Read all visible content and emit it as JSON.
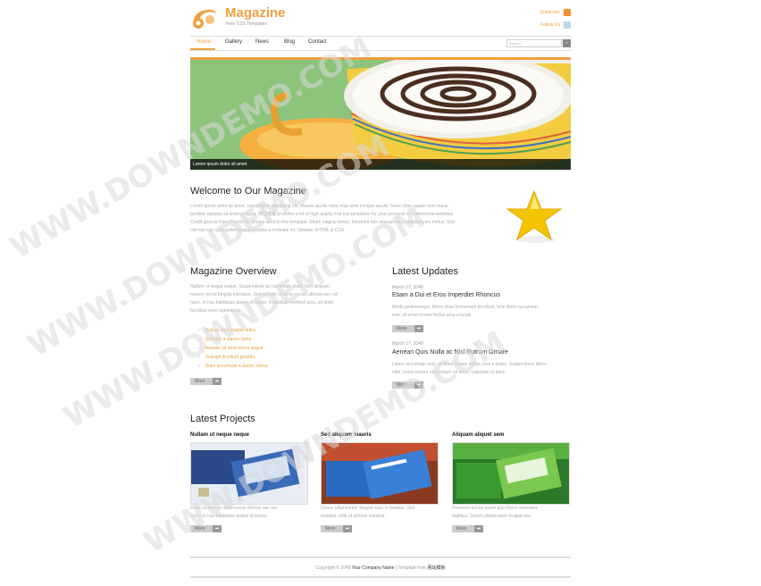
{
  "header": {
    "site_title": "Magazine",
    "tagline": "Free CSS Templates",
    "subscribe": "Subscribe",
    "follow": "Follow Us"
  },
  "nav": {
    "items": [
      "Home",
      "Gallery",
      "News",
      "Blog",
      "Contact"
    ],
    "active": "Home",
    "search_placeholder": "Search...",
    "search_button": "›"
  },
  "hero": {
    "caption": "Lorem ipsum dolor sit amet"
  },
  "welcome": {
    "title": "Welcome to Our Magazine",
    "lines": [
      "Lorem ipsum dolor sit amet, consectetur adipiscing elit. Mauris iaculis nulla vitae ante congue iaculis. Nunc vitae sapien sed neque",
      "porttitor egestas sit amet et ligula. 网站模板 provides a lot of high quality free css templates for your personal or commercial websites.",
      "Credit goes to Free Photos for photos used in this template. Etiam magna metus, hendrerit non aliquam nec, tincidunt nec metus. Sed",
      "nisl nisl nec nulla pellentesque sodales a molestie mi. Validate XHTML & CSS."
    ]
  },
  "overview": {
    "title": "Magazine Overview",
    "lines": [
      "Nullam ut neque neque. Suspendisse ac commodo diam. Sed aliquam",
      "mauris vel mi fringilla interdum. Sed vel nibh et urna cursus ultrices nec vel",
      "nunc. In hac habitasse platea dictumst. In pretium eleifend arcu, sit amet",
      "faucibus nunc egestas ac."
    ],
    "list": [
      "Nullam eget magna tellus",
      "Quisque a sapien tortor",
      "Aenean sit amet libero augue",
      "Suscipit tincidunt gravida",
      "Diam accumsan a auctor metus"
    ],
    "more": "More"
  },
  "updates": {
    "title": "Latest Updates",
    "posts": [
      {
        "date": "March 27, 2048",
        "title": "Etiam a Dui et Eros Imperdiet Rhoncus",
        "lines": [
          "Morbi pellentesque, libero vitae fermentum tincidunt, felis libero accumsan",
          "erat, sit amet ornare lectus urna a turpis."
        ],
        "more": "More"
      },
      {
        "date": "March 17, 2048",
        "title": "Aenean Quis Nulla ac Nisl Rutrum Ornare",
        "lines": [
          "Libero accumsan erat, sit amet ornare lectus urna a turpis. Suspendisse libero",
          "nibh, lorem ornare elementum sit amet, vulputate et diam."
        ],
        "more": "More"
      }
    ]
  },
  "projects": {
    "title": "Latest Projects",
    "items": [
      {
        "title": "Nullam ut neque neque",
        "lines": [
          "Etiam ut nibh et urna cursus ultrices nec vel",
          "nunc. In hac habitasse platea dictumst."
        ],
        "more": "More"
      },
      {
        "title": "Sed aliquam mauris",
        "lines": [
          "Donec ullamcorper feugiat nunc in tempus. Sed",
          "sodales, nibh ut ultrices volutpat."
        ],
        "more": "More"
      },
      {
        "title": "Aliquam aliquet sem",
        "lines": [
          "Praesent auctor quam quis libero venenatis",
          "dapibus. Donec ullamcorper feugiat nisi."
        ],
        "more": "More"
      }
    ]
  },
  "footer": {
    "prefix": "Copyright © 2048",
    "company": "Your Company Name",
    "middle": "| Template from",
    "source": "网站模板"
  },
  "watermark": {
    "text": "WWW.DOWNDEMO.COM"
  },
  "colors": {
    "accent": "#f0a040",
    "hero_bg": "#8ac07a"
  }
}
